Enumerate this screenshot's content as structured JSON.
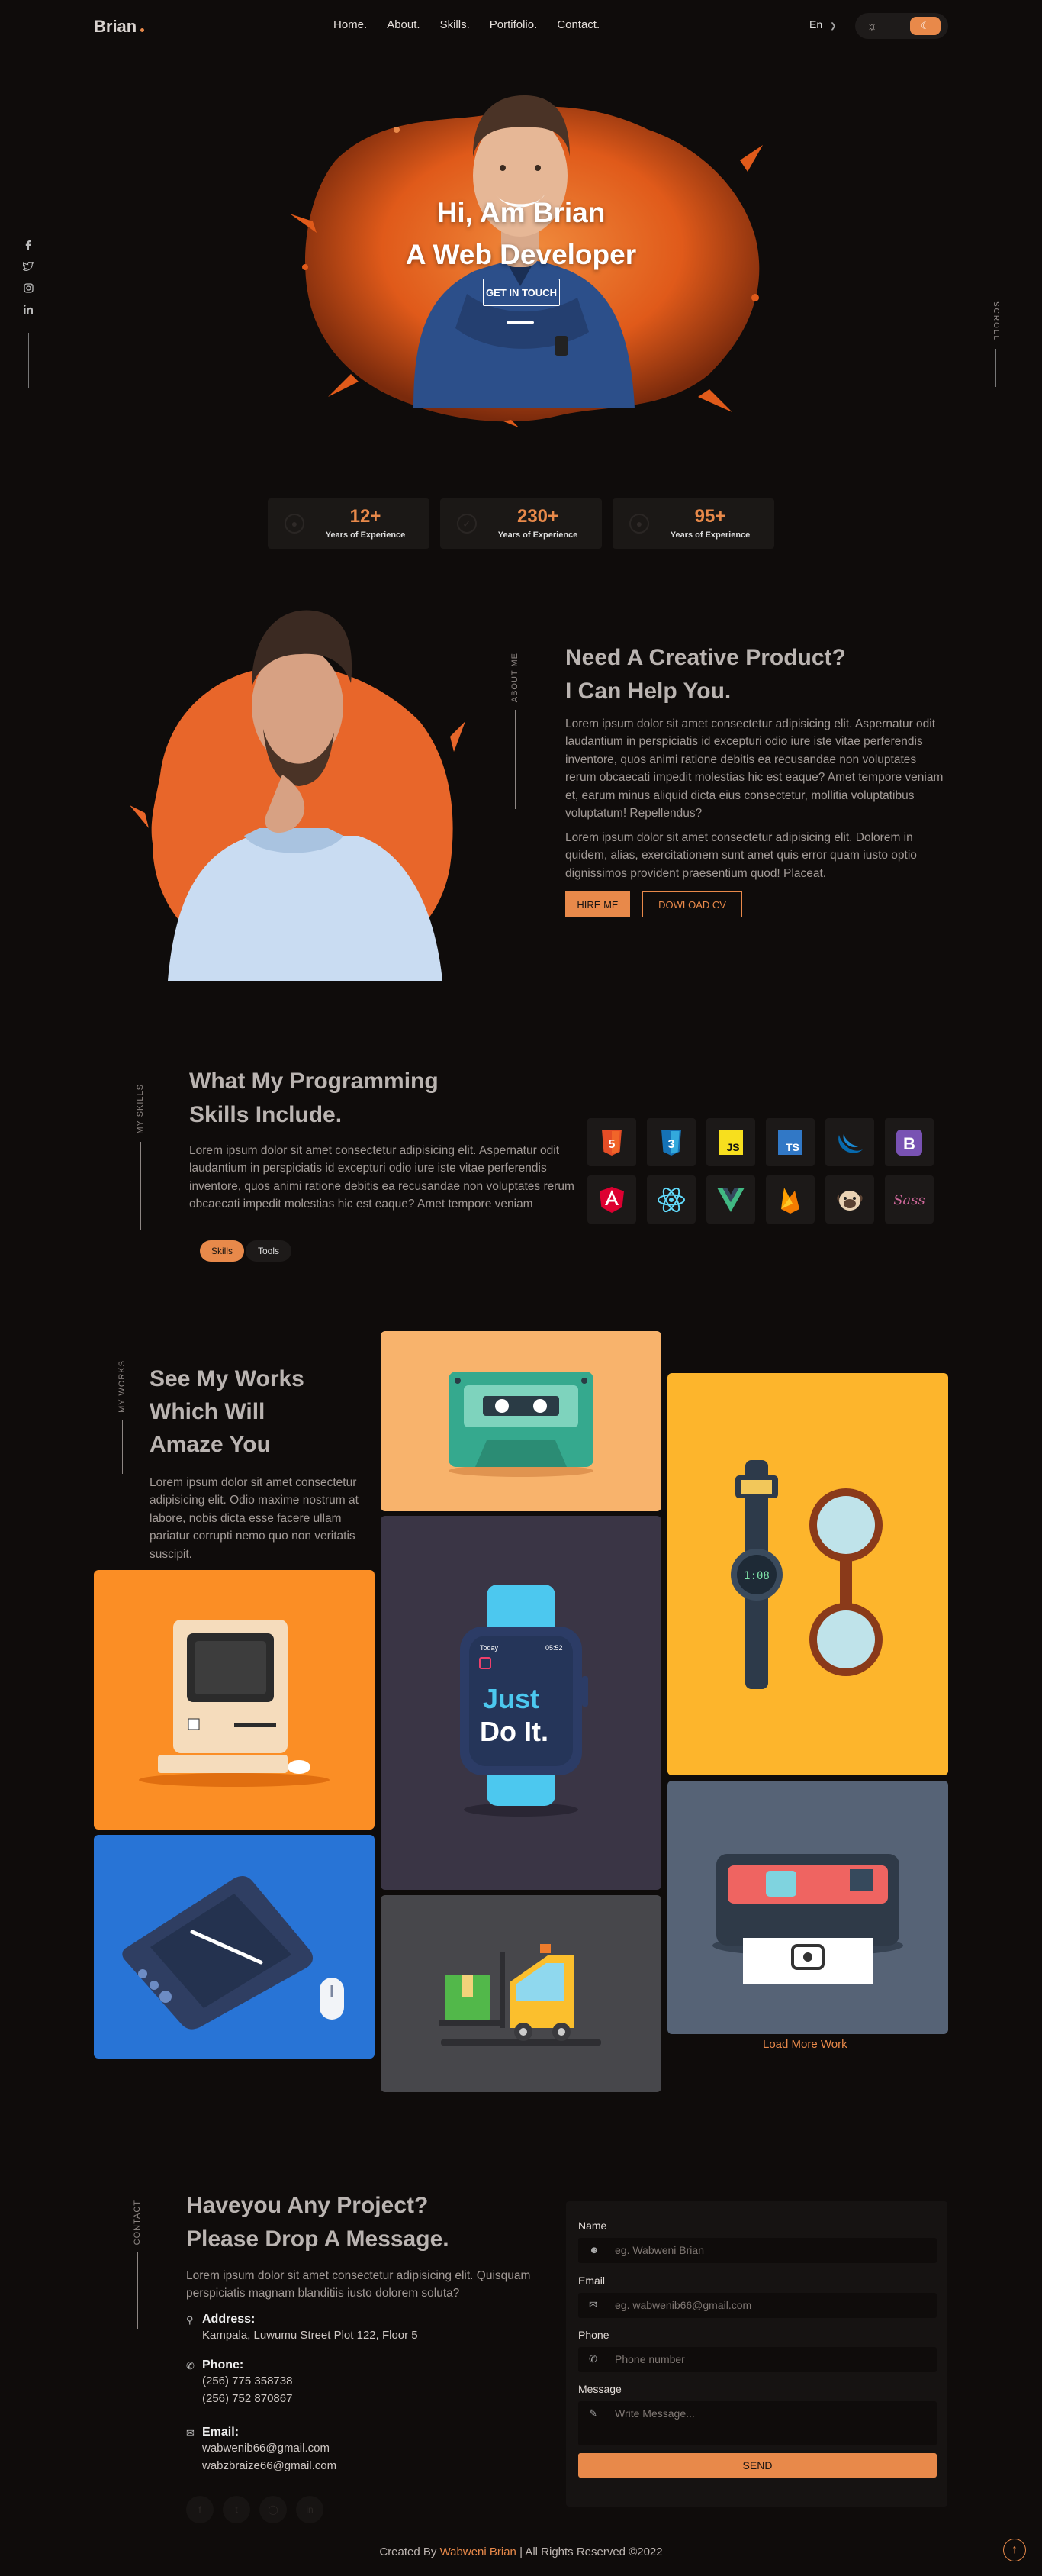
{
  "brand": {
    "logo": "Brian",
    "accent": "#e8894a"
  },
  "nav": {
    "items": [
      "Home.",
      "About.",
      "Skills.",
      "Portifolio.",
      "Contact."
    ],
    "lang": "En"
  },
  "hero": {
    "title1": "Hi, Am Brian",
    "title2": "A Web Developer",
    "cta": "GET IN TOUCH",
    "scroll_label": "SCROLL"
  },
  "stats": [
    {
      "value": "12+",
      "label": "Years of Experience"
    },
    {
      "value": "230+",
      "label": "Years of Experience"
    },
    {
      "value": "95+",
      "label": "Years of Experience"
    }
  ],
  "about": {
    "section_label": "ABOUT ME",
    "heading1": "Need A Creative Product?",
    "heading2": "I Can Help You.",
    "p1": "Lorem ipsum dolor sit amet consectetur adipisicing elit. Aspernatur odit laudantium in perspiciatis id excepturi odio iure iste vitae perferendis inventore, quos animi ratione debitis ea recusandae non voluptates rerum obcaecati impedit molestias hic est eaque? Amet tempore veniam et, earum minus aliquid dicta eius consectetur, mollitia voluptatibus voluptatum! Repellendus?",
    "p2": "Lorem ipsum dolor sit amet consectetur adipisicing elit. Dolorem in quidem, alias, exercitationem sunt amet quis error quam iusto optio dignissimos provident praesentium quod! Placeat.",
    "hire": "HIRE ME",
    "cv": "DOWLOAD CV"
  },
  "skills": {
    "section_label": "MY SKILLS",
    "heading1": "What My Programming",
    "heading2": "Skills Include.",
    "p": "Lorem ipsum dolor sit amet consectetur adipisicing elit. Aspernatur odit laudantium in perspiciatis id excepturi odio iure iste vitae perferendis inventore, quos animi ratione debitis ea recusandae non voluptates rerum obcaecati impedit molestias hic est eaque? Amet tempore veniam",
    "tab_on": "Skills",
    "tab_off": "Tools",
    "icons": [
      "html5-icon",
      "css3-icon",
      "javascript-icon",
      "typescript-icon",
      "jquery-icon",
      "bootstrap-icon",
      "angular-icon",
      "react-icon",
      "vue-icon",
      "firebase-icon",
      "pug-icon",
      "sass-icon"
    ],
    "labels": {
      "js": "JS",
      "ts": "TS",
      "b": "B",
      "sass": "Sass",
      "h5": "5",
      "c3": "3"
    }
  },
  "works": {
    "section_label": "MY WORKS",
    "heading1": "See My Works",
    "heading2": "Which Will",
    "heading3": "Amaze You",
    "p": "Lorem ipsum dolor sit amet consectetur adipisicing elit. Odio maxime nostrum at labore, nobis dicta esse facere ullam pariatur corrupti nemo quo non veritatis suscipit.",
    "watch_screen": {
      "top_left": "Today",
      "top_right": "05:52",
      "line1": "Just",
      "line2": "Do It."
    },
    "wrist_time": "1:08",
    "load_more": "Load More Work"
  },
  "contact": {
    "section_label": "CONTACT",
    "heading1": "Haveyou Any Project?",
    "heading2": "Please Drop A Message.",
    "p": "Lorem ipsum dolor sit amet consectetur adipisicing elit. Quisquam perspiciatis magnam blanditiis iusto dolorem soluta?",
    "address_title": "Address:",
    "address": "Kampala, Luwumu Street Plot 122, Floor 5",
    "phone_title": "Phone:",
    "phone1": "(256) 775 358738",
    "phone2": "(256) 752 870867",
    "email_title": "Email:",
    "email1": "wabwenib66@gmail.com",
    "email2": "wabzbraize66@gmail.com",
    "form": {
      "name_label": "Name",
      "name_ph": "eg. Wabweni Brian",
      "email_label": "Email",
      "email_ph": "eg. wabwenib66@gmail.com",
      "phone_label": "Phone",
      "phone_ph": "Phone number",
      "message_label": "Message",
      "message_ph": "Write Message...",
      "send": "SEND"
    }
  },
  "footer": {
    "prefix": "Created By ",
    "name": "Wabweni Brian",
    "suffix": " | All Rights Reserved ©2022"
  }
}
